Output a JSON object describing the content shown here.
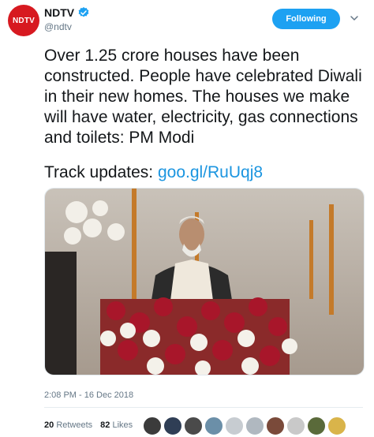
{
  "account": {
    "logo_text": "NDTV",
    "display_name": "NDTV",
    "handle": "@ndtv",
    "verified_icon": "verified-badge-icon",
    "follow_label": "Following"
  },
  "tweet": {
    "text": "Over 1.25 crore houses have been constructed. People have celebrated Diwali in their new homes. The houses we make will have water, electricity, gas connections and toilets: PM Modi",
    "track_prefix": "Track updates: ",
    "link_text": "goo.gl/RuUqj8",
    "timestamp": "2:08 PM - 16 Dec 2018"
  },
  "stats": {
    "retweets_count": "20",
    "retweets_label": "Retweets",
    "likes_count": "82",
    "likes_label": "Likes"
  },
  "likers": [
    "#3b3b3b",
    "#2f3e55",
    "#4a4a4a",
    "#6b8fa8",
    "#c7ccd1",
    "#b0b8c0",
    "#7a4a3a",
    "#c9c9c9",
    "#5a6a3a",
    "#d9b44a"
  ],
  "colors": {
    "brand": "#d71920",
    "accent": "#1da1f2",
    "link": "#1b95e0",
    "muted": "#657786"
  }
}
